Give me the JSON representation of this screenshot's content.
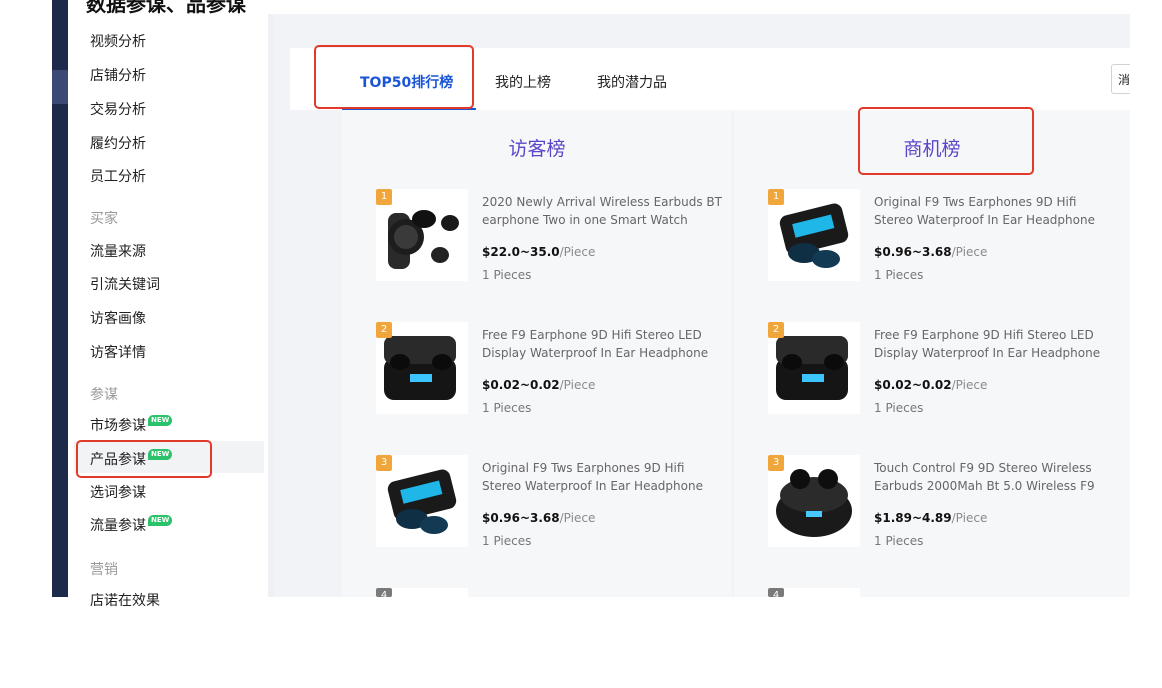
{
  "top_cut_text": "数据参谋、品参谋",
  "sidebar": {
    "items_top": [
      "视频分析",
      "店铺分析",
      "交易分析",
      "履约分析",
      "员工分析"
    ],
    "group_buyer": "买家",
    "items_buyer": [
      "流量来源",
      "引流关键词",
      "访客画像",
      "访客详情"
    ],
    "group_advisor": "参谋",
    "items_advisor": [
      {
        "label": "市场参谋",
        "badge": "NEW"
      },
      {
        "label": "产品参谋",
        "badge": "NEW"
      },
      {
        "label": "选词参谋",
        "badge": ""
      },
      {
        "label": "流量参谋",
        "badge": "NEW"
      }
    ],
    "group_marketing": "营销",
    "cut_item": "店诺在效果"
  },
  "tabs": [
    "TOP50排行榜",
    "我的上榜",
    "我的潜力品"
  ],
  "partial_select_text": "消",
  "panels": [
    {
      "title": "访客榜",
      "items": [
        {
          "rank": "1",
          "title": "2020 Newly Arrival Wireless Earbuds BT earphone Two in one Smart Watch",
          "price": "$22.0~35.0",
          "unit": "/Piece",
          "moq": "1 Pieces"
        },
        {
          "rank": "2",
          "title": "Free F9 Earphone 9D Hifi Stereo LED Display Waterproof In Ear Headphone",
          "price": "$0.02~0.02",
          "unit": "/Piece",
          "moq": "1 Pieces"
        },
        {
          "rank": "3",
          "title": "Original F9 Tws Earphones 9D Hifi Stereo Waterproof In Ear Headphone",
          "price": "$0.96~3.68",
          "unit": "/Piece",
          "moq": "1 Pieces"
        },
        {
          "rank": "4"
        }
      ]
    },
    {
      "title": "商机榜",
      "items": [
        {
          "rank": "1",
          "title": "Original F9 Tws Earphones 9D Hifi Stereo Waterproof In Ear Headphone",
          "price": "$0.96~3.68",
          "unit": "/Piece",
          "moq": "1 Pieces"
        },
        {
          "rank": "2",
          "title": "Free F9 Earphone 9D Hifi Stereo LED Display Waterproof In Ear Headphone",
          "price": "$0.02~0.02",
          "unit": "/Piece",
          "moq": "1 Pieces"
        },
        {
          "rank": "3",
          "title": "Touch Control F9 9D Stereo Wireless Earbuds 2000Mah Bt 5.0 Wireless F9",
          "price": "$1.89~4.89",
          "unit": "/Piece",
          "moq": "1 Pieces"
        },
        {
          "rank": "4"
        }
      ]
    }
  ],
  "colors": {
    "accent": "#1a55d6",
    "panel_title": "#5b45c9",
    "annotation": "#e23a2a",
    "rank_badge": "#f0a63a",
    "new_badge": "#2cc26b"
  }
}
